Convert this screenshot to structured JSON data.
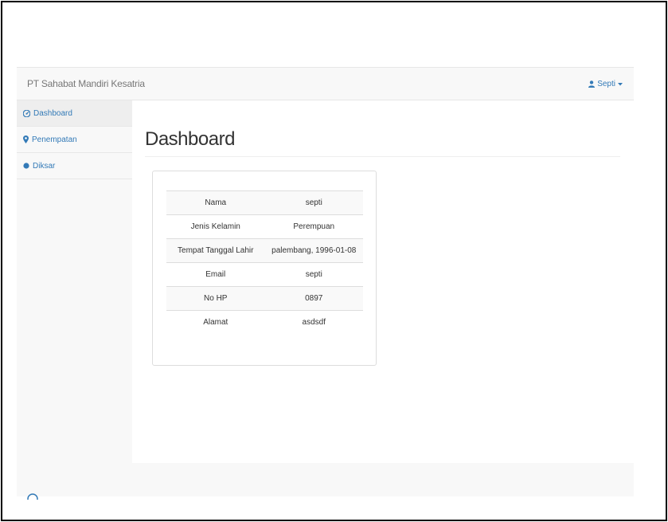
{
  "navbar": {
    "brand": "PT Sahabat Mandiri Kesatria",
    "user": {
      "label": "Septi",
      "icon": "user-icon",
      "caret": "caret-down-icon"
    }
  },
  "sidebar": {
    "items": [
      {
        "label": "Dashboard",
        "icon": "dashboard-icon",
        "active": true
      },
      {
        "label": "Penempatan",
        "icon": "map-marker-icon",
        "active": false
      },
      {
        "label": "Diksar",
        "icon": "circle-icon",
        "active": false
      }
    ]
  },
  "main": {
    "title": "Dashboard",
    "profile": {
      "rows": [
        {
          "label": "Nama",
          "value": "septi"
        },
        {
          "label": "Jenis Kelamin",
          "value": "Perempuan"
        },
        {
          "label": "Tempat Tanggal Lahir",
          "value": "palembang, 1996-01-08"
        },
        {
          "label": "Email",
          "value": "septi"
        },
        {
          "label": "No HP",
          "value": "0897"
        },
        {
          "label": "Alamat",
          "value": "asdsdf"
        }
      ]
    }
  },
  "colors": {
    "link": "#337ab7",
    "navbar_bg": "#f8f8f8",
    "border": "#dddddd",
    "active_bg": "#eeeeee"
  }
}
